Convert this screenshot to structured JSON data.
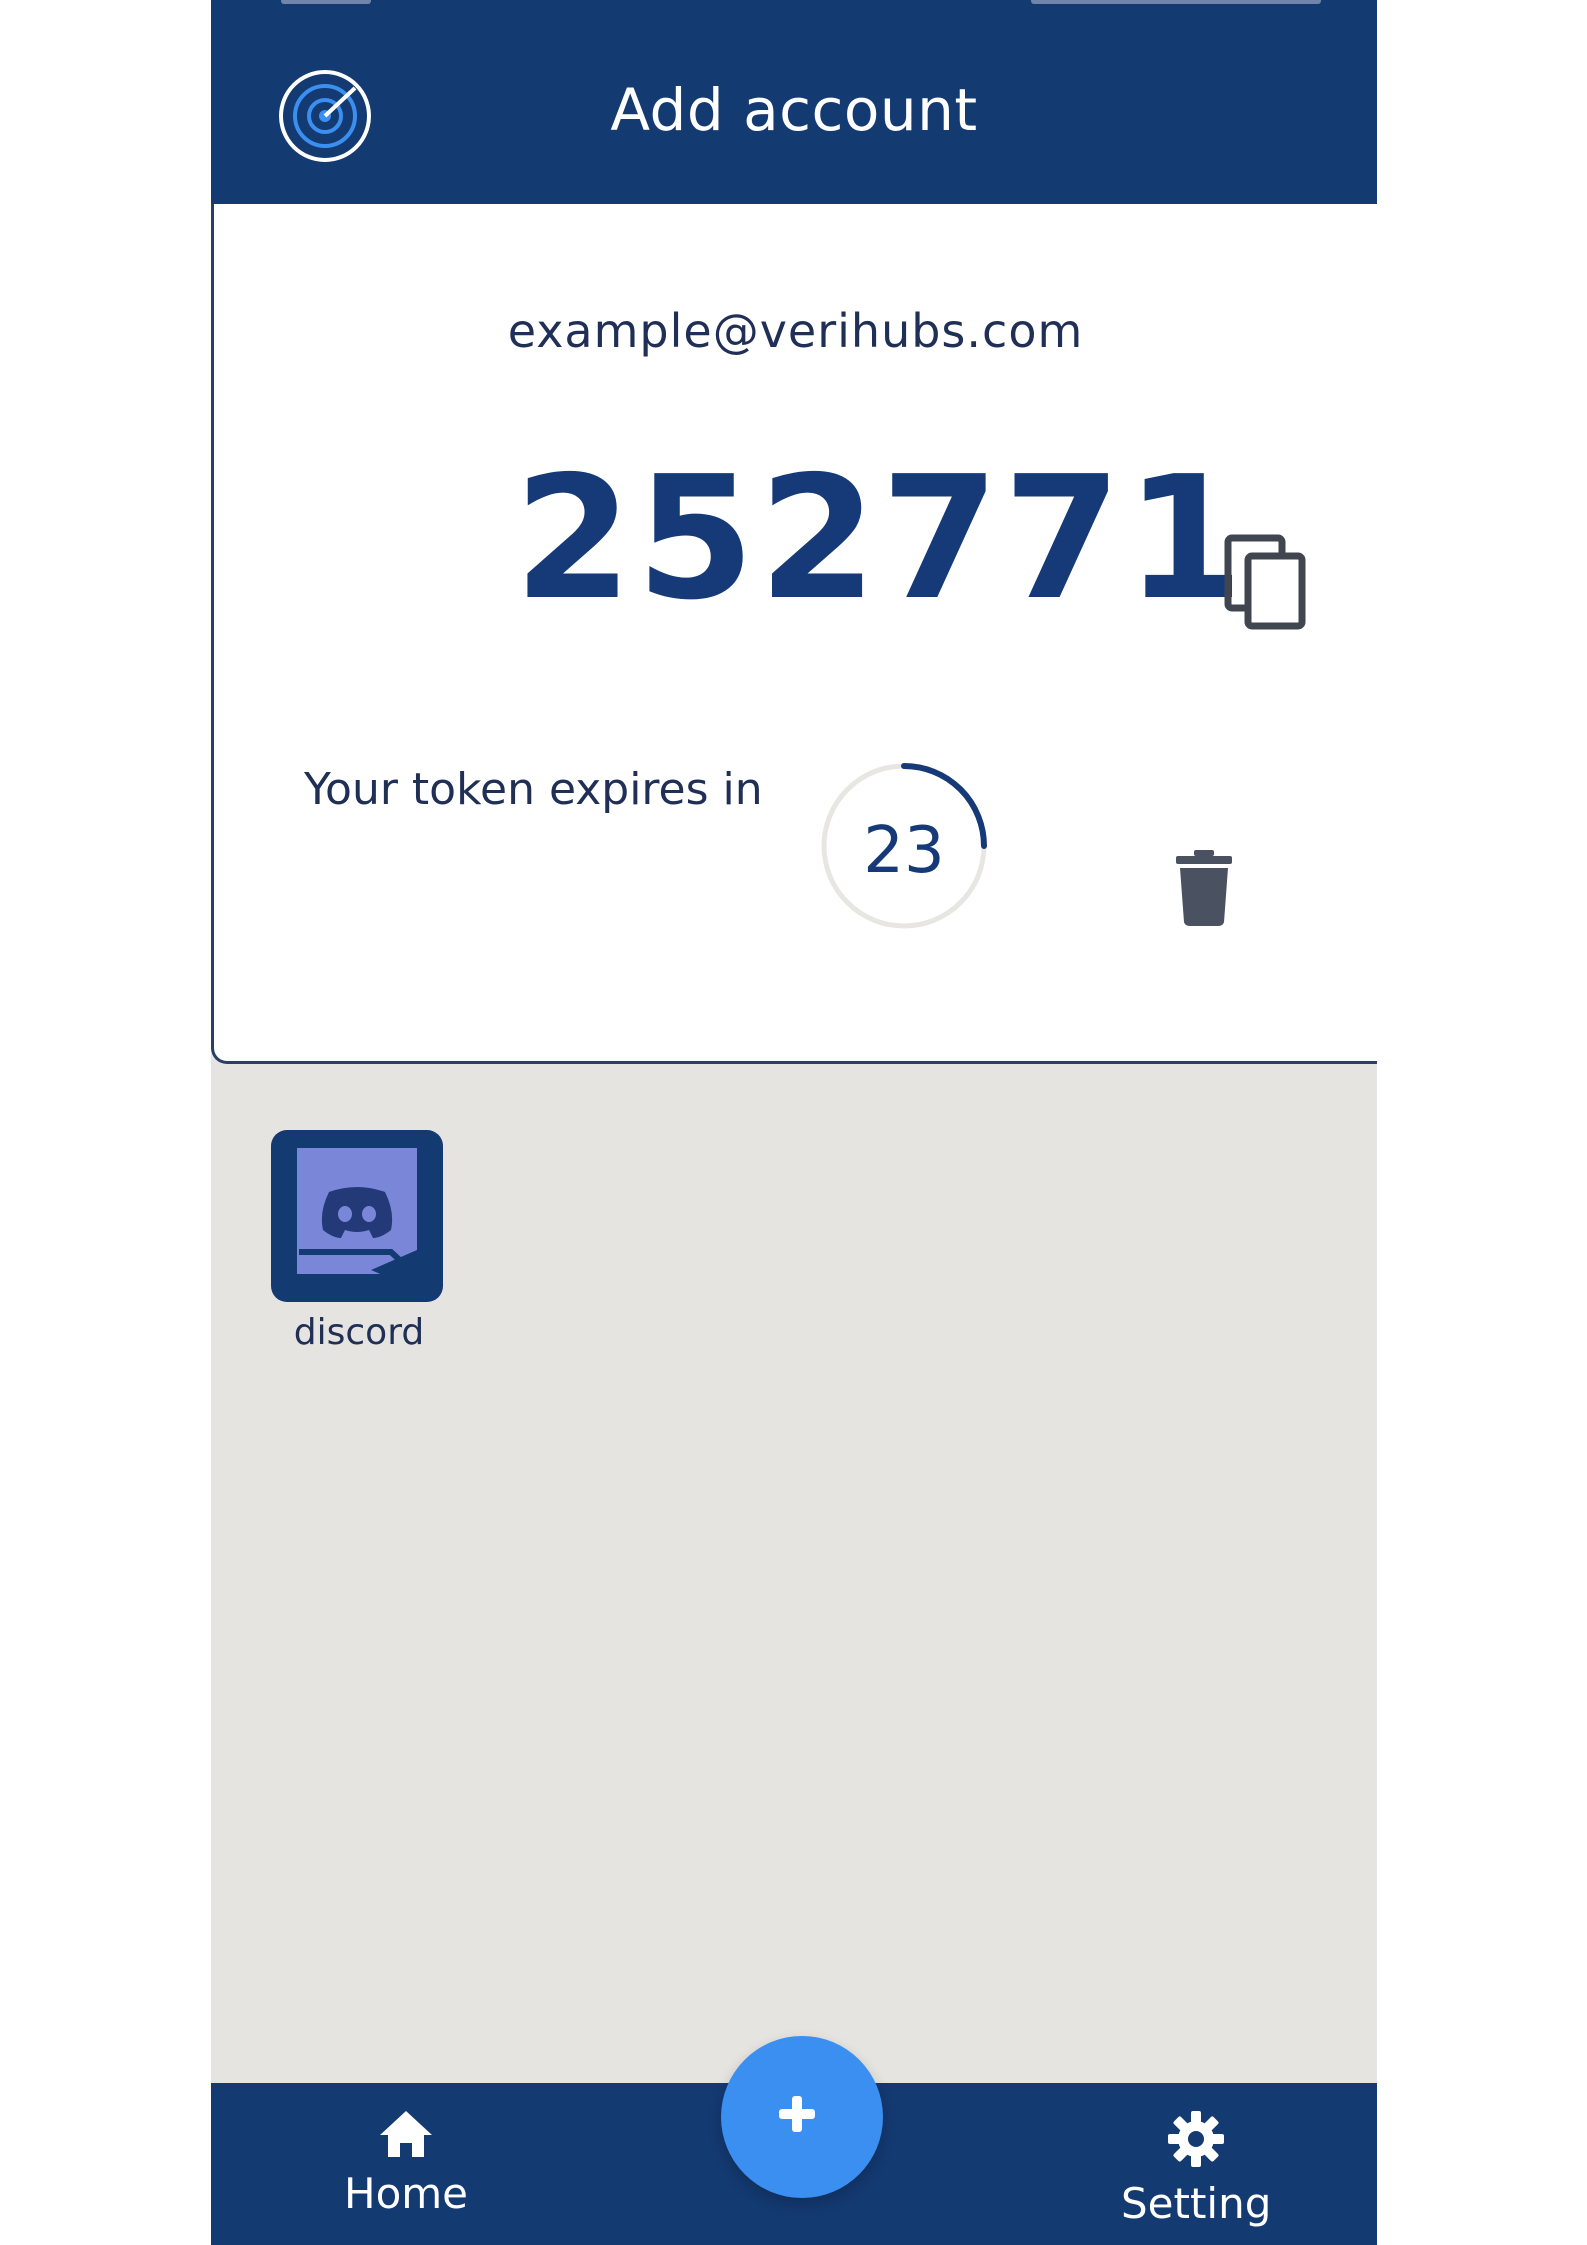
{
  "appbar": {
    "title": "Add account",
    "logo_icon": "target-icon"
  },
  "token": {
    "email": "example@verihubs.com",
    "code": "252771",
    "expires_label": "Your token expires in",
    "seconds_remaining": "23",
    "countdown_fraction": 0.25,
    "copy_icon": "copy-icon",
    "delete_icon": "trash-icon"
  },
  "services": [
    {
      "name": "discord",
      "icon": "discord-icon"
    }
  ],
  "bottom_nav": {
    "home_label": "Home",
    "home_icon": "home-icon",
    "setting_label": "Setting",
    "setting_icon": "gear-icon",
    "fab_icon": "plus-icon"
  },
  "colors": {
    "primary": "#143a72",
    "accent": "#3a8ff0",
    "background": "#e6e4e0",
    "card": "#ffffff",
    "discord": "#7289da"
  }
}
